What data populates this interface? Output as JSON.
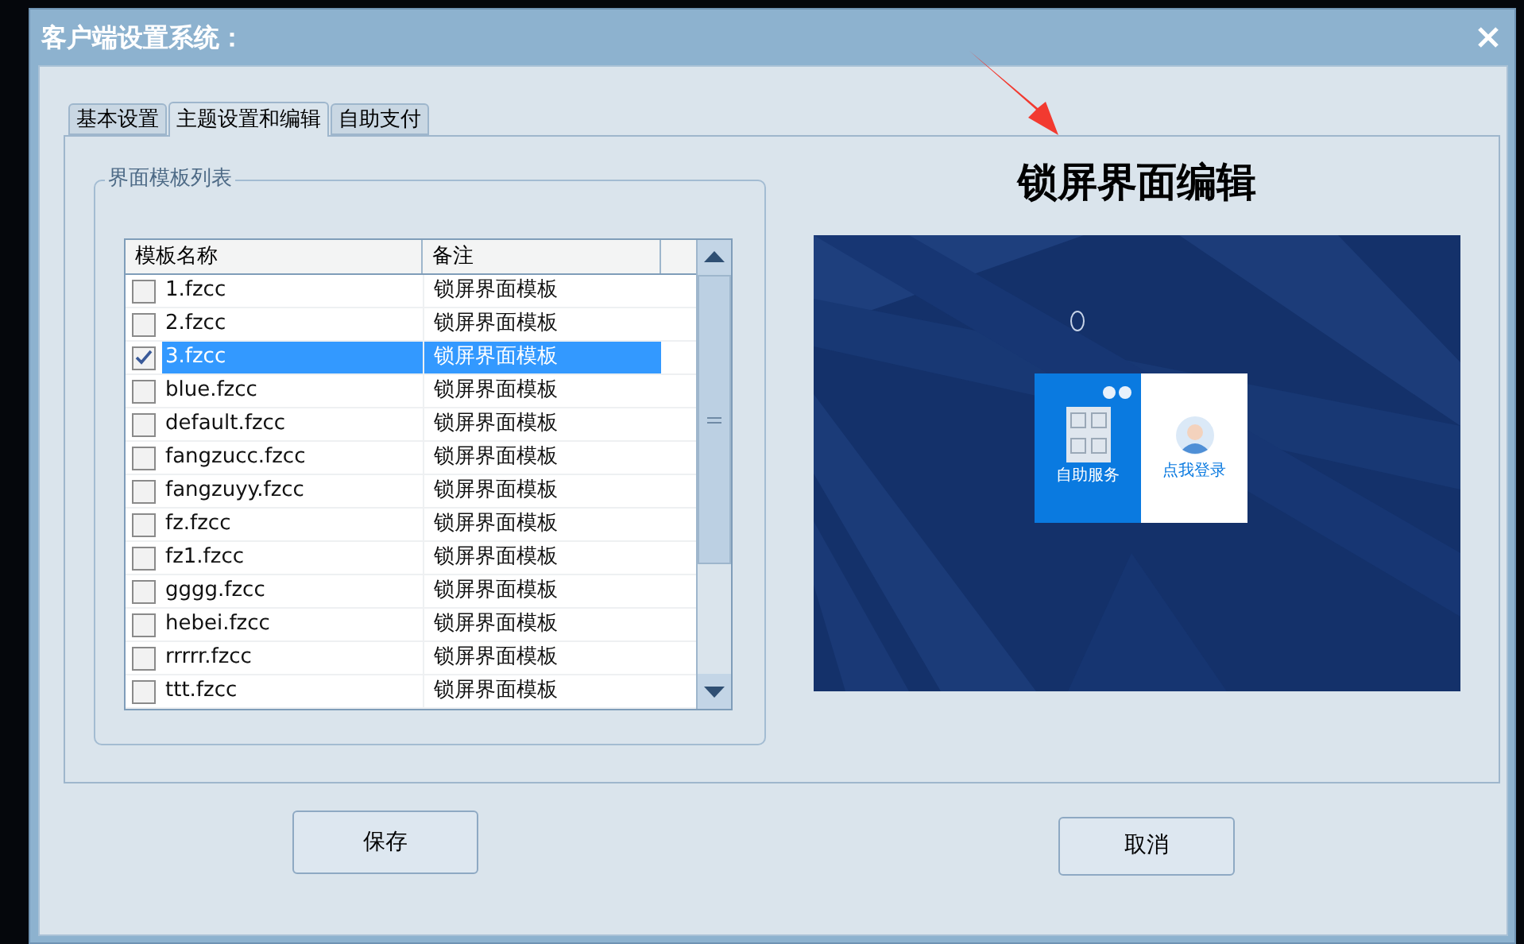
{
  "window": {
    "title": "客户端设置系统："
  },
  "tabs": [
    {
      "label": "基本设置",
      "selected": false
    },
    {
      "label": "主题设置和编辑",
      "selected": true
    },
    {
      "label": "自助支付",
      "selected": false
    }
  ],
  "template_group": {
    "title": "界面模板列表",
    "columns": [
      "模板名称",
      "备注"
    ],
    "rows": [
      {
        "name": "1.fzcc",
        "remark": "锁屏界面模板",
        "checked": false,
        "selected": false
      },
      {
        "name": "2.fzcc",
        "remark": "锁屏界面模板",
        "checked": false,
        "selected": false
      },
      {
        "name": "3.fzcc",
        "remark": "锁屏界面模板",
        "checked": true,
        "selected": true
      },
      {
        "name": "blue.fzcc",
        "remark": "锁屏界面模板",
        "checked": false,
        "selected": false
      },
      {
        "name": "default.fzcc",
        "remark": "锁屏界面模板",
        "checked": false,
        "selected": false
      },
      {
        "name": "fangzucc.fzcc",
        "remark": "锁屏界面模板",
        "checked": false,
        "selected": false
      },
      {
        "name": "fangzuyy.fzcc",
        "remark": "锁屏界面模板",
        "checked": false,
        "selected": false
      },
      {
        "name": "fz.fzcc",
        "remark": "锁屏界面模板",
        "checked": false,
        "selected": false
      },
      {
        "name": "fz1.fzcc",
        "remark": "锁屏界面模板",
        "checked": false,
        "selected": false
      },
      {
        "name": "gggg.fzcc",
        "remark": "锁屏界面模板",
        "checked": false,
        "selected": false
      },
      {
        "name": "hebei.fzcc",
        "remark": "锁屏界面模板",
        "checked": false,
        "selected": false
      },
      {
        "name": "rrrrr.fzcc",
        "remark": "锁屏界面模板",
        "checked": false,
        "selected": false
      },
      {
        "name": "ttt.fzcc",
        "remark": "锁屏界面模板",
        "checked": false,
        "selected": false
      }
    ]
  },
  "preview": {
    "heading": "锁屏界面编辑",
    "self_service": "自助服务",
    "login": "点我登录"
  },
  "buttons": [
    "保存",
    "取消"
  ]
}
